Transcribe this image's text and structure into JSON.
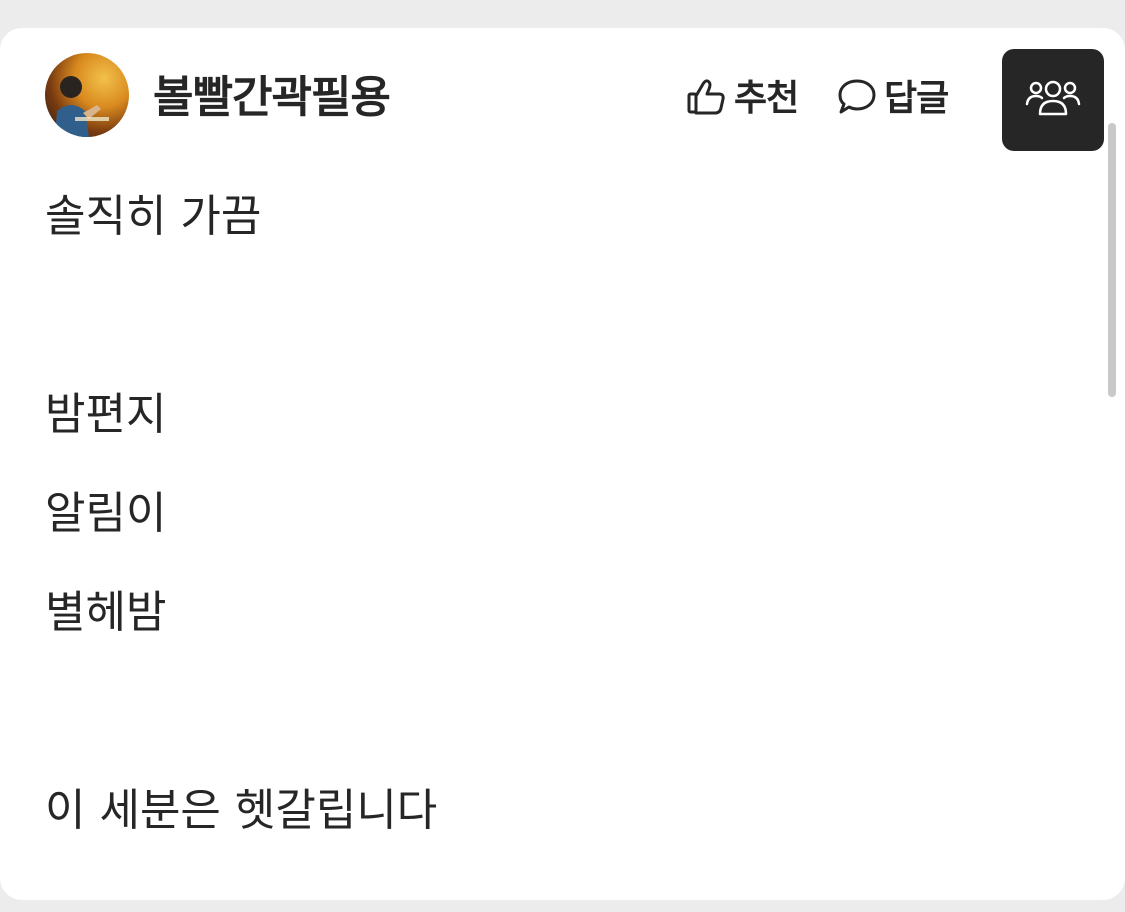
{
  "post": {
    "author": "볼빨간곽필용",
    "actions": {
      "recommend_label": "추천",
      "reply_label": "답글"
    },
    "icons": {
      "recommend": "thumbs-up-icon",
      "reply": "speech-bubble-icon",
      "group": "group-users-icon"
    },
    "lines": [
      "솔직히 가끔",
      "밤편지",
      "알림이",
      "별헤밤",
      "이 세분은 헷갈립니다"
    ]
  },
  "colors": {
    "background": "#ececec",
    "card": "#ffffff",
    "text": "#262626",
    "group_button": "#262626",
    "scrollbar": "#c8c8c8"
  }
}
